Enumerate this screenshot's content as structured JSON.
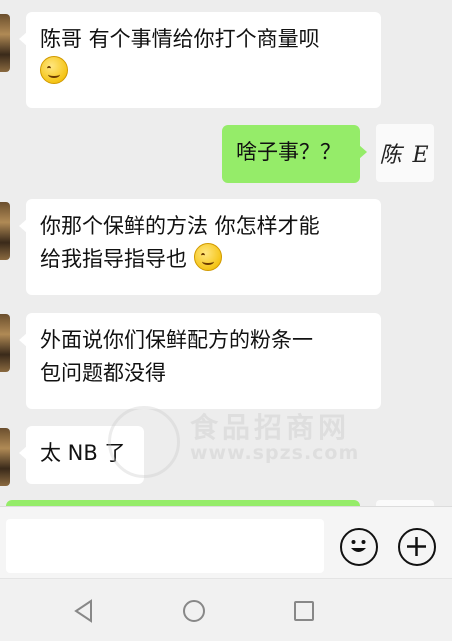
{
  "messages": [
    {
      "side": "left",
      "text": "陈哥 有个事情给你打个商量呗",
      "emoji": "grinning-face"
    },
    {
      "side": "right",
      "text": "啥子事？？"
    },
    {
      "side": "left",
      "line1": "你那个保鲜的方法 你怎样才能",
      "line2": "给我指导指导也",
      "emoji": "smiling-face"
    },
    {
      "side": "left",
      "line1": "外面说你们保鲜配方的粉条一",
      "line2": "包问题都没得"
    },
    {
      "side": "left",
      "text": "太 NB 了"
    }
  ],
  "contact_avatar_text": "陈 E",
  "watermark": {
    "cn": "食品招商网",
    "en": "www.spzs.com"
  },
  "input": {
    "placeholder": ""
  },
  "icons": {
    "emoji_button": "smile-icon",
    "plus_button": "plus-icon",
    "back": "back-triangle-icon",
    "home": "home-circle-icon",
    "recents": "recents-square-icon"
  },
  "colors": {
    "background": "#ededed",
    "incoming_bubble": "#ffffff",
    "outgoing_bubble": "#95ec69"
  }
}
